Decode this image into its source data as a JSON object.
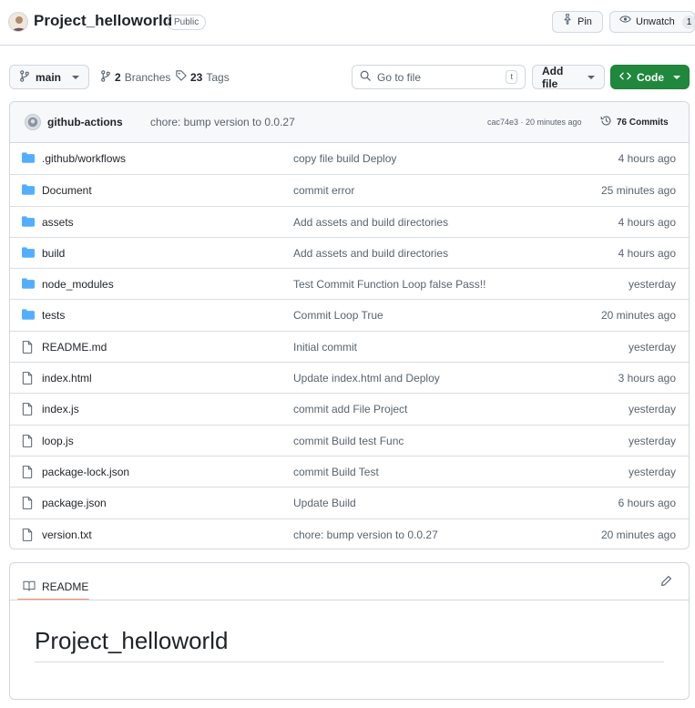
{
  "repo": {
    "name": "Project_helloworld",
    "visibility": "Public",
    "pin_label": "Pin",
    "watch_label": "Unwatch",
    "watch_count": "1"
  },
  "toolbar": {
    "branch": "main",
    "branches_count": "2",
    "branches_label": "Branches",
    "tags_count": "23",
    "tags_label": "Tags",
    "search_placeholder": "Go to file",
    "search_shortcut": "t",
    "add_file_label": "Add file",
    "code_label": "Code"
  },
  "latest_commit": {
    "author": "github-actions",
    "message": "chore: bump version to 0.0.27",
    "meta": "cac74e3 · 20 minutes ago",
    "commits_count": "76 Commits"
  },
  "files": [
    {
      "type": "folder",
      "name": ".github/workflows",
      "message": "copy file build Deploy",
      "age": "4 hours ago"
    },
    {
      "type": "folder",
      "name": "Document",
      "message": "commit error",
      "age": "25 minutes ago"
    },
    {
      "type": "folder",
      "name": "assets",
      "message": "Add assets and build directories",
      "age": "4 hours ago"
    },
    {
      "type": "folder",
      "name": "build",
      "message": "Add assets and build directories",
      "age": "4 hours ago"
    },
    {
      "type": "folder",
      "name": "node_modules",
      "message": "Test Commit Function Loop false Pass!!",
      "age": "yesterday"
    },
    {
      "type": "folder",
      "name": "tests",
      "message": "Commit Loop True",
      "age": "20 minutes ago"
    },
    {
      "type": "file",
      "name": "README.md",
      "message": "Initial commit",
      "age": "yesterday"
    },
    {
      "type": "file",
      "name": "index.html",
      "message": "Update index.html and Deploy",
      "age": "3 hours ago"
    },
    {
      "type": "file",
      "name": "index.js",
      "message": "commit add File Project",
      "age": "yesterday"
    },
    {
      "type": "file",
      "name": "loop.js",
      "message": "commit Build test Func",
      "age": "yesterday"
    },
    {
      "type": "file",
      "name": "package-lock.json",
      "message": "commit Build Test",
      "age": "yesterday"
    },
    {
      "type": "file",
      "name": "package.json",
      "message": "Update Build",
      "age": "6 hours ago"
    },
    {
      "type": "file",
      "name": "version.txt",
      "message": "chore: bump version to 0.0.27",
      "age": "20 minutes ago"
    }
  ],
  "readme": {
    "tab_label": "README",
    "heading": "Project_helloworld"
  },
  "colors": {
    "folder": "#54aeff",
    "code_button": "#1f883d",
    "readme_underline": "#fd8c73"
  }
}
